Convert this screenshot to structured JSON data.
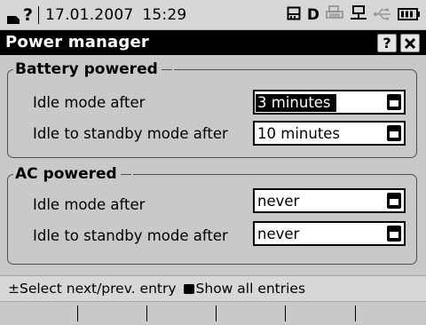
{
  "status_bar": {
    "date": "17.01.2007",
    "time": "15:29",
    "icons": [
      "keyboard-icon",
      "question-mark-icon",
      "memory-card-icon",
      "d-indicator-icon",
      "printer-icon",
      "network-icon",
      "usb-icon",
      "battery-icon"
    ],
    "drive_letter": "D",
    "question_mark": "?"
  },
  "window": {
    "title": "Power manager",
    "help_label": "?",
    "close_label": "✕"
  },
  "groups": [
    {
      "title": "Battery powered",
      "rows": [
        {
          "label": "Idle mode after",
          "value": "3 minutes",
          "selected": true
        },
        {
          "label": "Idle to standby mode after",
          "value": "10 minutes",
          "selected": false
        }
      ]
    },
    {
      "title": "AC powered",
      "rows": [
        {
          "label": "Idle mode after",
          "value": "never",
          "selected": false
        },
        {
          "label": "Idle to standby mode after",
          "value": "never",
          "selected": false
        }
      ]
    }
  ],
  "help_line": {
    "select_symbol": "±",
    "select_text": "Select next/prev. entry",
    "show_text": "Show all entries"
  },
  "softkeys": [
    "",
    "",
    "",
    "",
    "",
    ""
  ]
}
